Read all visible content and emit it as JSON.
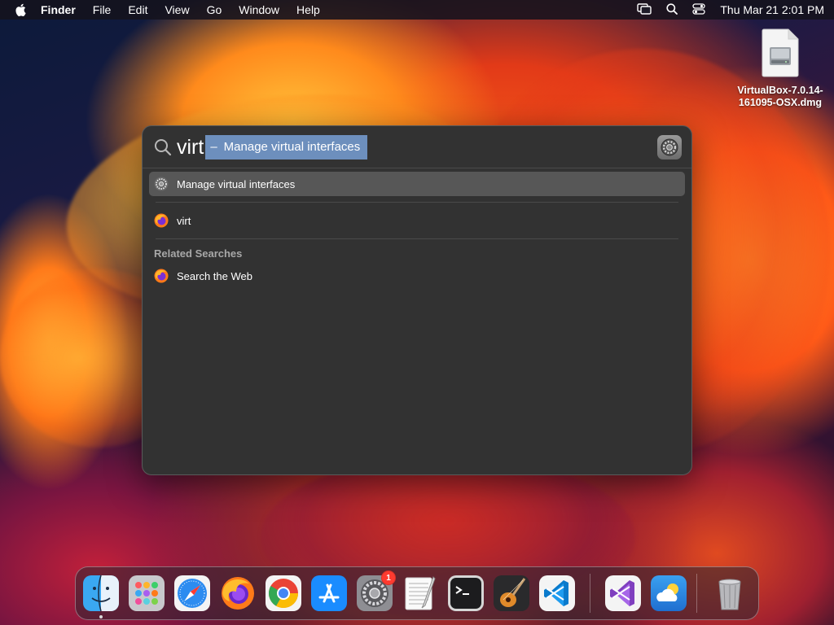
{
  "menubar": {
    "app_name": "Finder",
    "menus": [
      "File",
      "Edit",
      "View",
      "Go",
      "Window",
      "Help"
    ],
    "clock": "Thu Mar 21  2:01 PM",
    "status_icons": [
      "screen-mirroring-icon",
      "search-icon",
      "control-center-icon"
    ]
  },
  "desktop": {
    "file_label": "VirtualBox-7.0.14-161095-OSX.dmg"
  },
  "spotlight": {
    "query": "virt",
    "completion_dash": "–",
    "completion_text": "Manage virtual interfaces",
    "results": [
      {
        "label": "Manage virtual interfaces",
        "icon": "system-settings-icon",
        "selected": true
      },
      {
        "label": "virt",
        "icon": "firefox-icon",
        "selected": false
      }
    ],
    "related_title": "Related Searches",
    "related": [
      {
        "label": "Search the Web",
        "icon": "firefox-icon"
      }
    ]
  },
  "dock": {
    "apps": [
      {
        "name": "Finder",
        "running": true
      },
      {
        "name": "Launchpad"
      },
      {
        "name": "Safari"
      },
      {
        "name": "Firefox"
      },
      {
        "name": "Chrome"
      },
      {
        "name": "App Store"
      },
      {
        "name": "System Settings",
        "badge": "1"
      },
      {
        "name": "TextEdit"
      },
      {
        "name": "Terminal"
      },
      {
        "name": "GarageBand"
      },
      {
        "name": "Visual Studio Code"
      },
      {
        "name": "Visual Studio"
      },
      {
        "name": "Weather"
      },
      {
        "name": "Trash"
      }
    ]
  },
  "colors": {
    "spotlight_bg": "#323232",
    "selection": "#575757",
    "completion_highlight": "#6d8fbd",
    "badge": "#ff3b30"
  }
}
